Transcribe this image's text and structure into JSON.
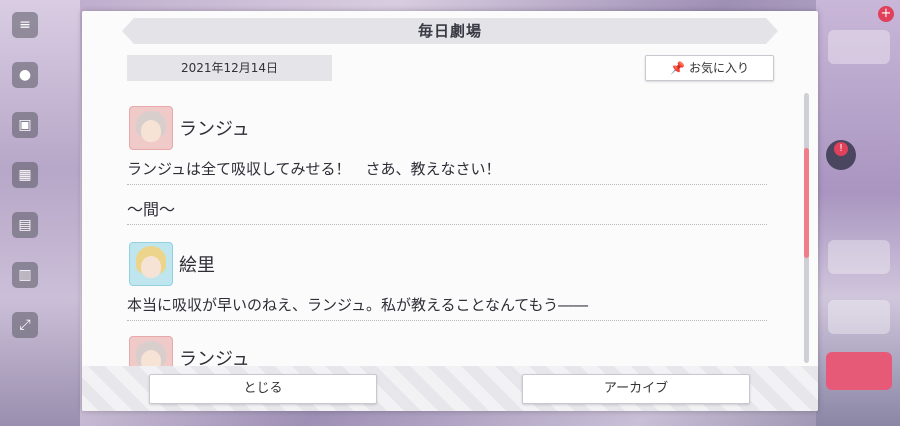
{
  "dialog": {
    "title": "毎日劇場",
    "date": "2021年12月14日",
    "favorite_label": "お気に入り"
  },
  "entries": [
    {
      "speaker": "ランジュ",
      "text": "ランジュは全て吸収してみせる！　さあ、教えなさい！"
    },
    {
      "interlude": "〜間〜"
    },
    {
      "speaker": "絵里",
      "text": "本当に吸収が早いのねえ、ランジュ。私が教えることなんてもう――"
    },
    {
      "speaker": "ランジュ"
    }
  ],
  "footer": {
    "close_label": "とじる",
    "archive_label": "アーカイブ"
  },
  "icons": {
    "favorite": "pin-icon",
    "menu": "hamburger-menu-icon"
  },
  "colors": {
    "scroll_thumb": "#ef7e8a",
    "accent_red": "#e0405a"
  }
}
